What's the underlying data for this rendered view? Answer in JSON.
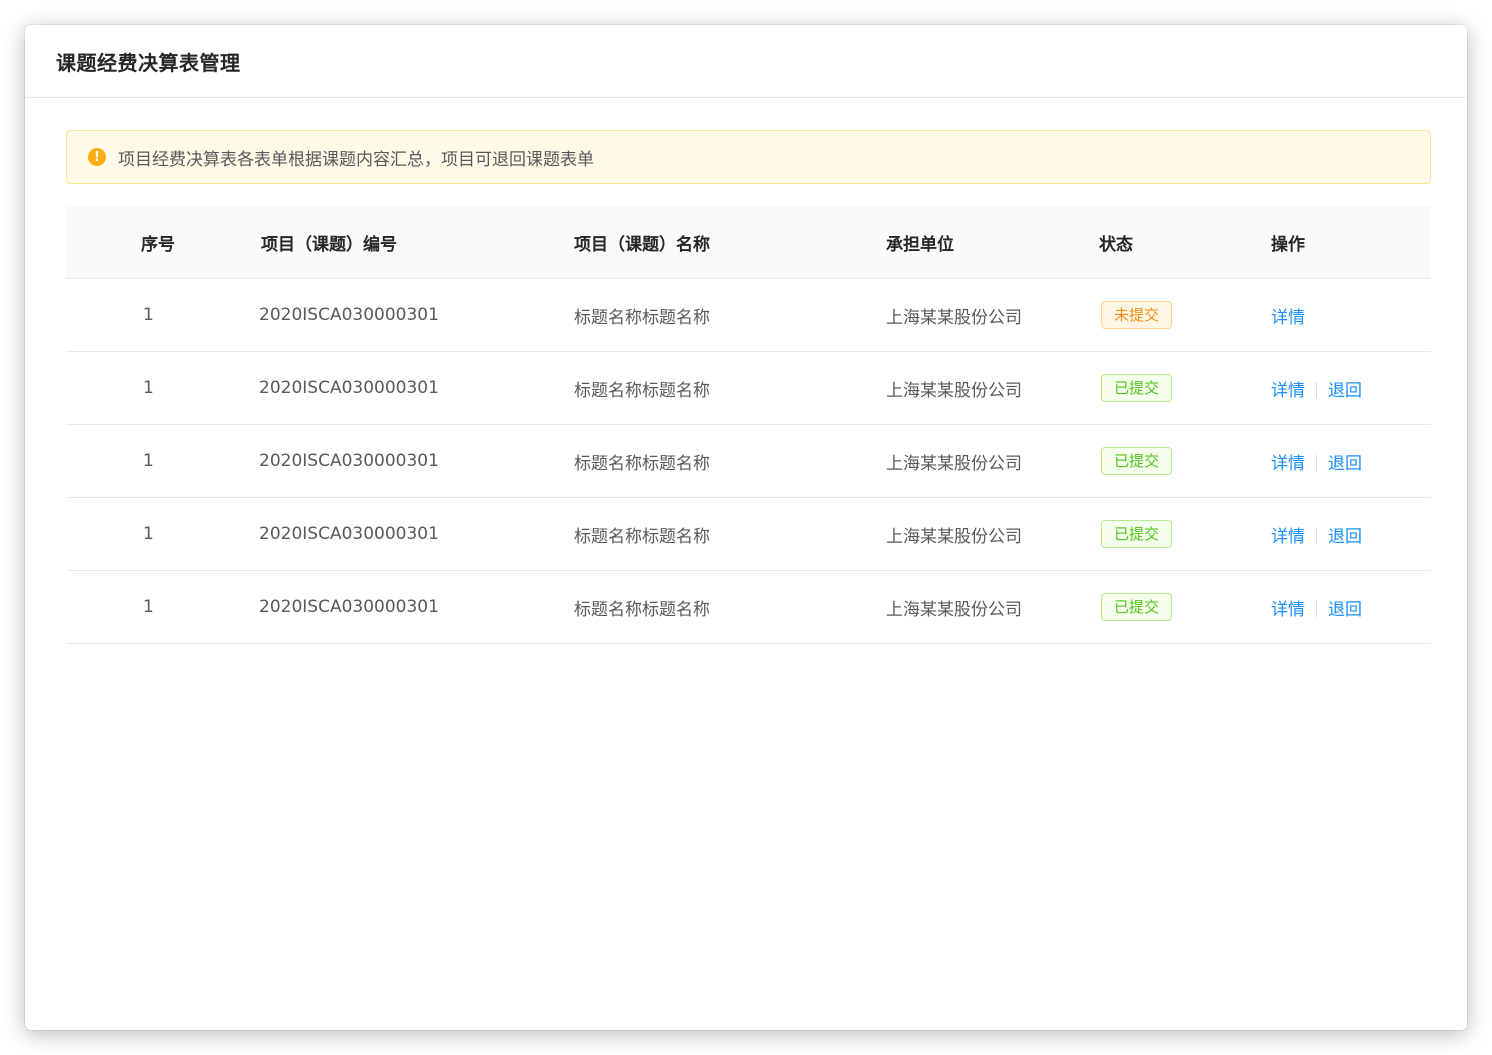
{
  "page": {
    "title": "课题经费决算表管理"
  },
  "alert": {
    "icon": "warning-circle-icon",
    "icon_glyph": "!",
    "text": "项目经费决算表各表单根据课题内容汇总，项目可退回课题表单"
  },
  "table": {
    "columns": [
      "序号",
      "项目（课题）编号",
      "项目（课题）名称",
      "承担单位",
      "状态",
      "操作"
    ],
    "rows": [
      {
        "index": "1",
        "code": "2020ISCA030000301",
        "name": "标题名称标题名称",
        "unit": "上海某某股份公司",
        "status": "未提交",
        "status_type": "warning",
        "actions": [
          "详情"
        ]
      },
      {
        "index": "1",
        "code": "2020ISCA030000301",
        "name": "标题名称标题名称",
        "unit": "上海某某股份公司",
        "status": "已提交",
        "status_type": "success",
        "actions": [
          "详情",
          "退回"
        ]
      },
      {
        "index": "1",
        "code": "2020ISCA030000301",
        "name": "标题名称标题名称",
        "unit": "上海某某股份公司",
        "status": "已提交",
        "status_type": "success",
        "actions": [
          "详情",
          "退回"
        ]
      },
      {
        "index": "1",
        "code": "2020ISCA030000301",
        "name": "标题名称标题名称",
        "unit": "上海某某股份公司",
        "status": "已提交",
        "status_type": "success",
        "actions": [
          "详情",
          "退回"
        ]
      },
      {
        "index": "1",
        "code": "2020ISCA030000301",
        "name": "标题名称标题名称",
        "unit": "上海某某股份公司",
        "status": "已提交",
        "status_type": "success",
        "actions": [
          "详情",
          "退回"
        ]
      }
    ]
  },
  "colors": {
    "link": "#1890ff",
    "warning": "#fa8c16",
    "success": "#52c41a",
    "alert_bg": "#fffbe6",
    "alert_border": "#ffe58f"
  }
}
